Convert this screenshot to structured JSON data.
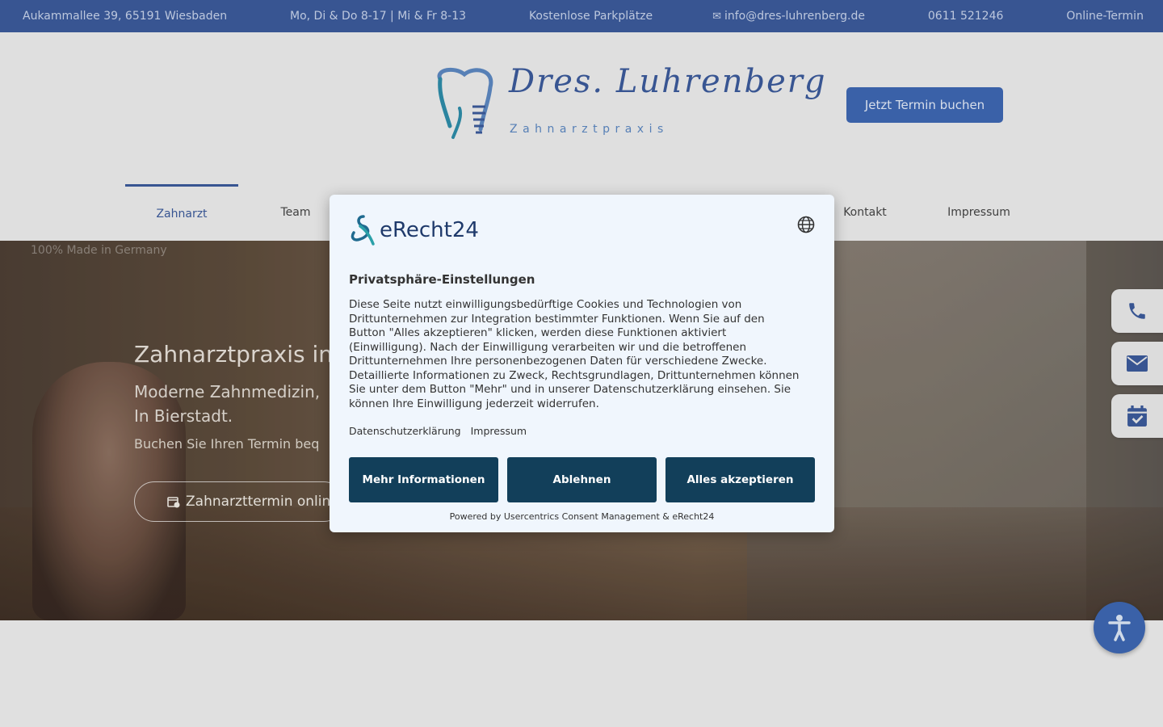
{
  "topbar": {
    "address": "Aukammallee 39, 65191 Wiesbaden",
    "hours": "Mo, Di & Do 8-17 | Mi & Fr 8-13",
    "parking": "Kostenlose Parkplätze",
    "email": "info@dres-luhrenberg.de",
    "phone": "0611 521246",
    "online": "Online-Termin",
    "glyph": "",
    "mail_glyph": "✉"
  },
  "header": {
    "logo_script": "Dres. Luhrenberg",
    "logo_sub": "Zahnarztpraxis",
    "cta_label": "Jetzt Termin buchen"
  },
  "nav": {
    "items": [
      {
        "label": "Zahnarzt"
      },
      {
        "label": "Team "
      },
      {
        "label": "Kontakt "
      },
      {
        "label": "Impressum "
      }
    ]
  },
  "hero": {
    "watermark": "100% Made in Germany",
    "title": "Zahnarztpraxis in W",
    "subtitle": "Moderne Zahnmedizin, In Bierstadt.",
    "subtitle2": "Buchen Sie Ihren Termin beq",
    "button_label": "Zahnarzttermin online"
  },
  "consent": {
    "brand": "eRecht24",
    "title": "Privatsphäre-Einstellungen",
    "text": "Diese Seite nutzt einwilligungsbedürftige Cookies und Technologien von Drittunternehmen zur Integration bestimmter Funktionen. Wenn Sie auf den Button \"Alles akzeptieren\" klicken, werden diese Funktionen aktiviert (Einwilligung). Nach der Einwilligung verarbeiten wir und die betroffenen Drittunternehmen Ihre personenbezogenen Daten für verschiedene Zwecke. Detaillierte Informationen zu Zweck, Rechtsgrundlagen, Drittunternehmen können Sie unter dem Button \"Mehr\" und in unserer Datenschutzerklärung einsehen. Sie können Ihre Einwilligung jederzeit widerrufen.",
    "link_privacy": "Datenschutzerklärung",
    "link_imprint": "Impressum",
    "btn_more": "Mehr Informationen",
    "btn_decline": "Ablehnen",
    "btn_accept": "Alles akzeptieren",
    "powered": "Powered by Usercentrics Consent Management & eRecht24"
  },
  "colors": {
    "brand": "#3b5a9a",
    "cta": "#3e67b1",
    "consent_button": "#123f5a"
  },
  "icons": {
    "side": [
      "phone-icon",
      "envelope-icon",
      "calendar-check-icon"
    ],
    "accessibility": "accessibility-icon",
    "language": "globe-icon"
  }
}
